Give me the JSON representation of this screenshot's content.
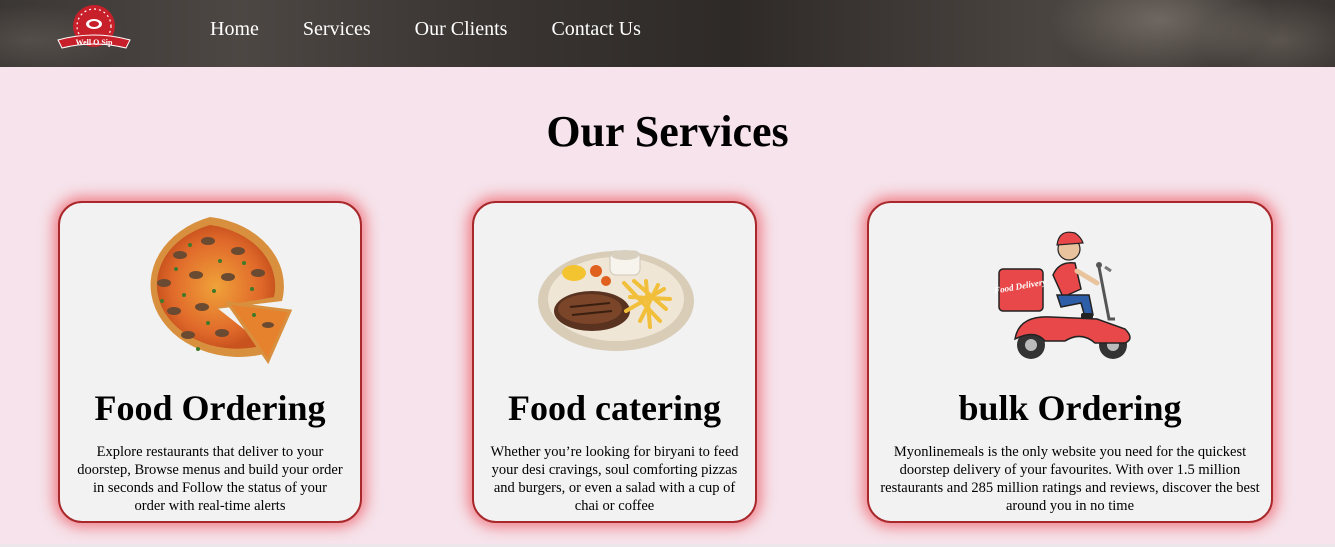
{
  "header": {
    "logo_text": "Well O Sip",
    "nav": [
      {
        "label": "Home"
      },
      {
        "label": "Services"
      },
      {
        "label": "Our Clients"
      },
      {
        "label": "Contact Us"
      }
    ]
  },
  "main": {
    "title": "Our Services",
    "cards": [
      {
        "title": "Food Ordering",
        "description": "Explore restaurants that deliver to your doorstep, Browse menus and build your order in seconds and Follow the status of your order with real-time alerts",
        "image": "pizza-image"
      },
      {
        "title": "Food catering",
        "description": "Whether you’re looking for biryani to feed your desi cravings, soul comforting pizzas and burgers, or even a salad with a cup of chai or coffee",
        "image": "steak-plate-image"
      },
      {
        "title": "bulk Ordering",
        "description": "Myonlinemeals is the only website you need for the quickest doorstep delivery of your favourites. With over 1.5 million restaurants and 285 million ratings and reviews, discover the best around you in no time",
        "image": "delivery-scooter-image",
        "badge_text": "Food Delivery"
      }
    ]
  },
  "colors": {
    "page_bg": "#f6e3eb",
    "card_bg": "#f2f2f2",
    "card_border": "#a8282b",
    "card_glow": "#eb2832",
    "header_bg": "#3b3734"
  }
}
